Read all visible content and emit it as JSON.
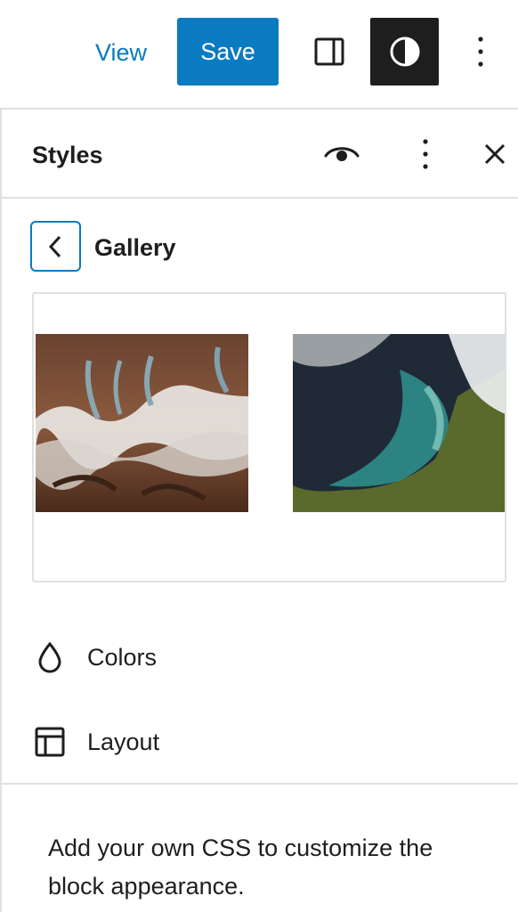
{
  "topbar": {
    "view_label": "View",
    "save_label": "Save",
    "sidebar_icon": "sidebar-icon",
    "styles_icon": "half-circle-icon",
    "more_icon": "vertical-ellipsis-icon"
  },
  "panel": {
    "title": "Styles",
    "preview_icon": "eye-icon",
    "more_icon": "vertical-ellipsis-icon",
    "close_icon": "close-icon"
  },
  "section": {
    "back_icon": "chevron-left-icon",
    "title": "Gallery"
  },
  "menu": [
    {
      "label": "Colors",
      "icon": "droplet-icon"
    },
    {
      "label": "Layout",
      "icon": "layout-icon"
    }
  ],
  "css_section": {
    "description": "Add your own CSS to customize the block appearance."
  },
  "colors": {
    "accent": "#0a7ac1",
    "dark": "#1e1e1e",
    "border": "#e0e0e0"
  }
}
